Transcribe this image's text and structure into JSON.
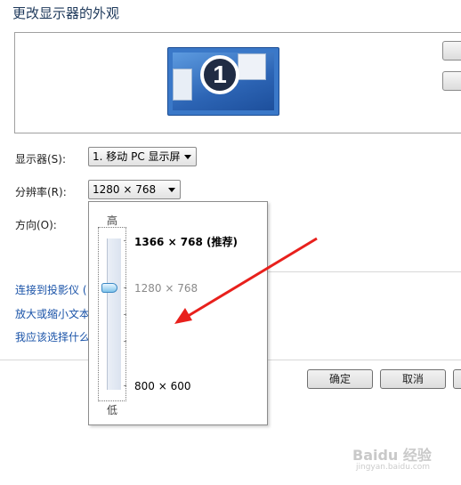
{
  "header": {
    "title": "更改显示器的外观"
  },
  "preview": {
    "monitor_number": "1"
  },
  "display": {
    "label": "显示器(S):",
    "value": "1. 移动 PC 显示屏"
  },
  "resolution": {
    "label": "分辨率(R):",
    "value": "1280 × 768",
    "popup": {
      "high_label": "高",
      "low_label": "低",
      "options": [
        {
          "text": "1366 × 768 (推荐)",
          "style": "recommended"
        },
        {
          "text": "1280 × 768",
          "style": "current"
        },
        {
          "text": "800 × 600",
          "style": "normal"
        }
      ],
      "slider_level": 0.71
    }
  },
  "orientation": {
    "label": "方向(O):"
  },
  "links": [
    {
      "text": "连接到投影仪 ("
    },
    {
      "text": "放大或缩小文本"
    },
    {
      "text": "我应该选择什么"
    }
  ],
  "buttons": {
    "ok": "确定",
    "cancel": "取消"
  },
  "watermark": {
    "text": "Baidu 经验",
    "sub": "jingyan.baidu.com"
  },
  "colors": {
    "annotation_arrow": "#e8201c",
    "link": "#1a53a8",
    "title": "#1e395b"
  }
}
